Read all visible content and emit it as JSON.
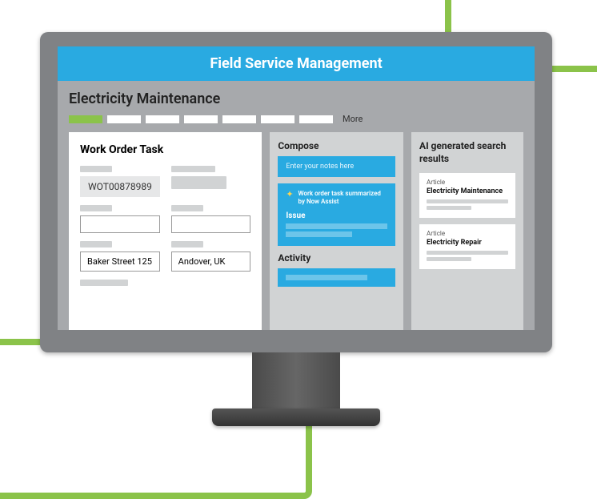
{
  "header": {
    "title": "Field Service Management"
  },
  "page": {
    "title": "Electricity Maintenance"
  },
  "tabs": {
    "more_label": "More"
  },
  "work_order": {
    "heading": "Work Order Task",
    "id": "WOT00878989",
    "address": "Baker Street 125",
    "city": "Andover, UK"
  },
  "compose": {
    "heading": "Compose",
    "placeholder": "Enter your notes here",
    "summary_text": "Work order task summarized by Now Assist",
    "issue_label": "Issue",
    "activity_heading": "Activity"
  },
  "search": {
    "heading": "AI generated search results",
    "results": [
      {
        "type": "Article",
        "title": "Electricity Maintenance"
      },
      {
        "type": "Article",
        "title": "Electricity Repair"
      }
    ]
  }
}
